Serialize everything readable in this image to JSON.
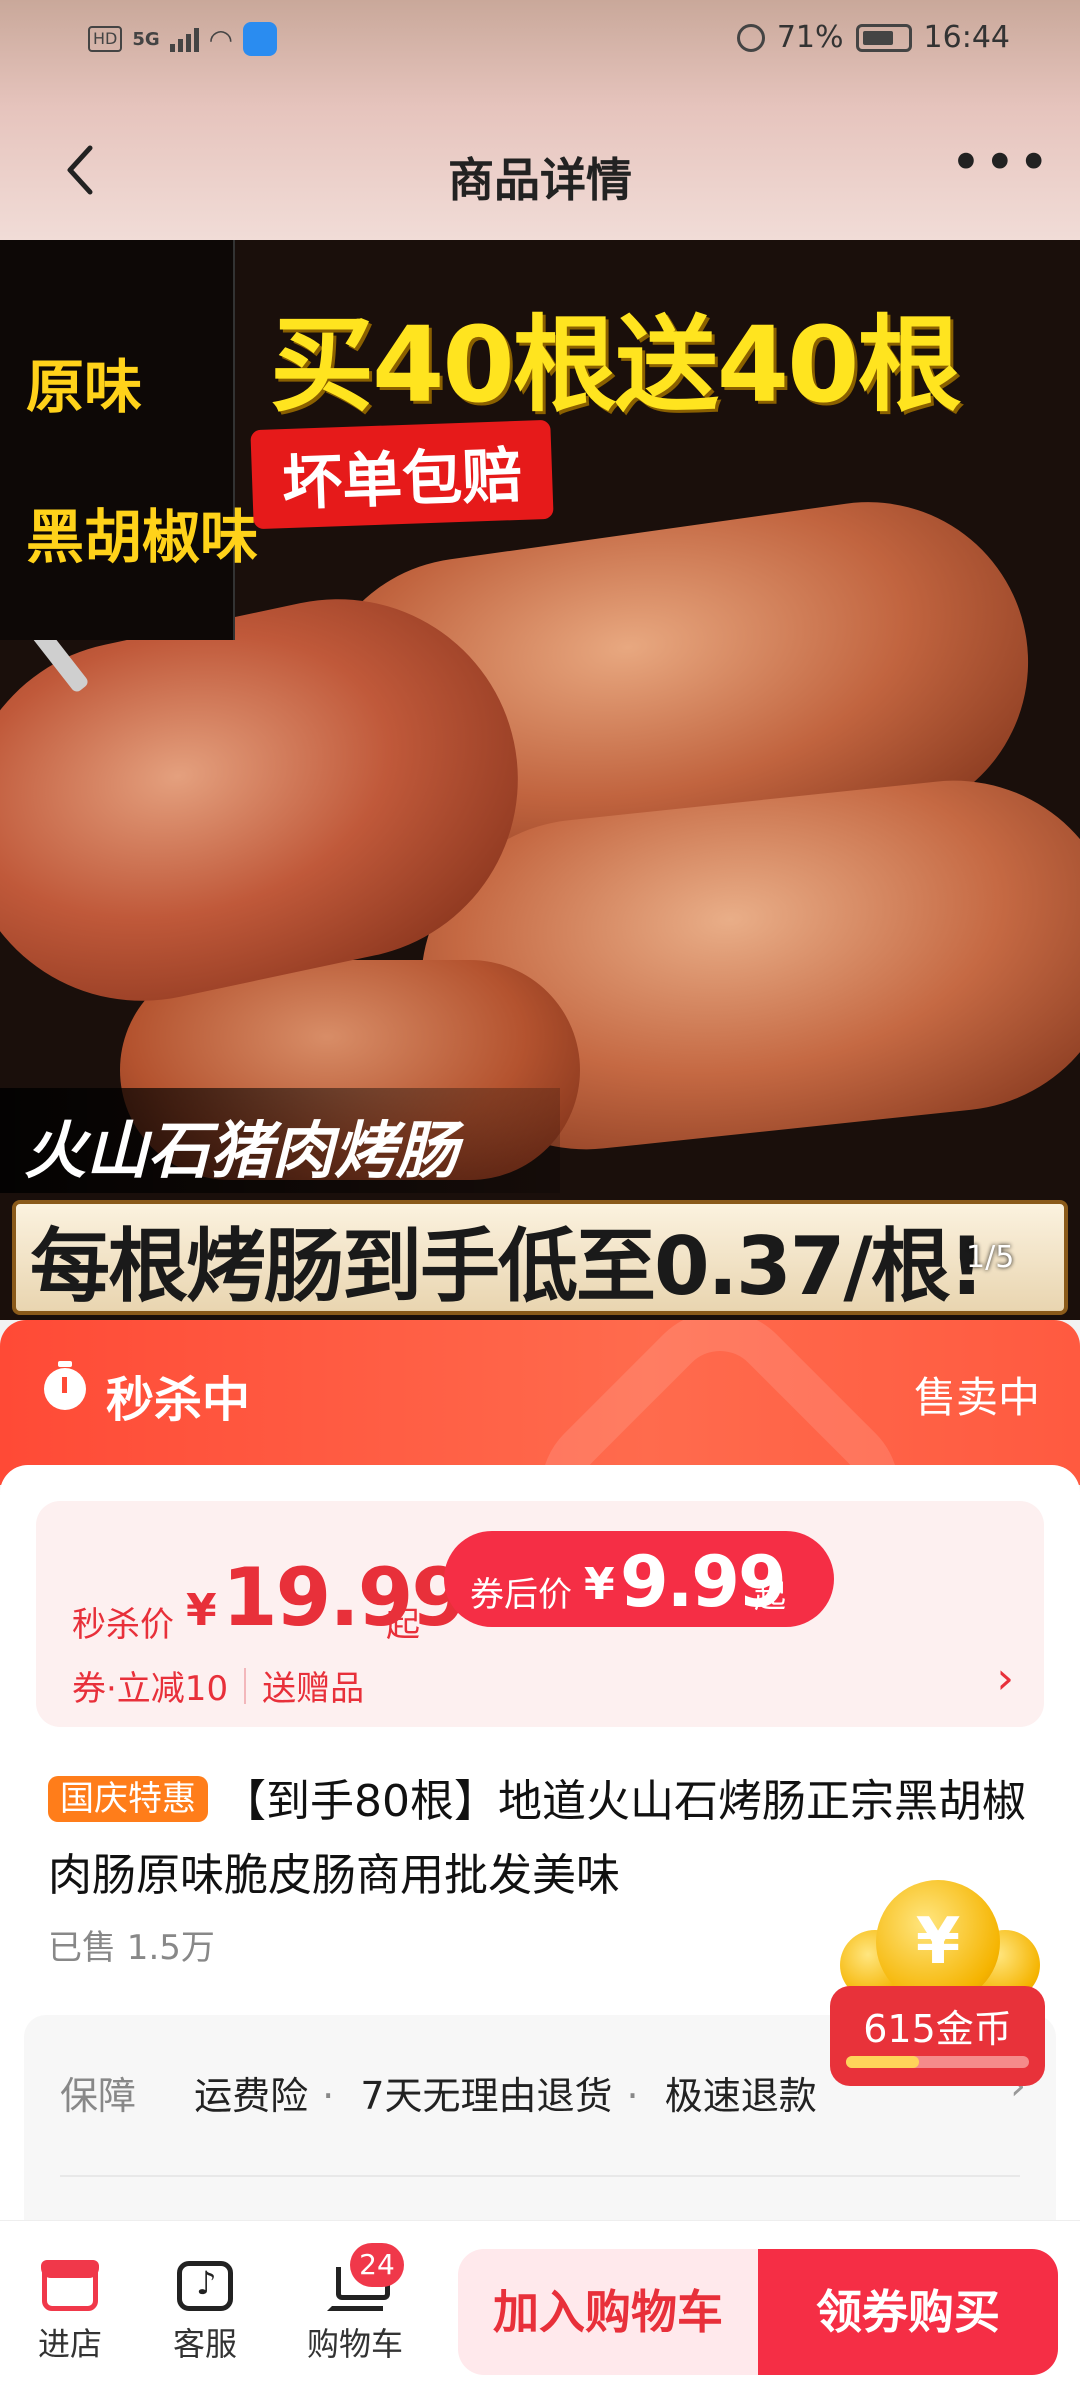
{
  "status_bar": {
    "hd": "HD",
    "network": "5G",
    "battery_pct": "71%",
    "time": "16:44"
  },
  "nav": {
    "back_icon": "chevron-left-icon",
    "title": "商品详情",
    "more_icon": "more-horizontal-icon"
  },
  "hero": {
    "flavors": [
      "原味",
      "黑胡椒味"
    ],
    "headline": "买40根送40根",
    "badge": "坏单包赔",
    "subtitle": "火山石猪肉烤肠",
    "price_banner": "每根烤肠到手低至0.37/根!",
    "counter": "1/5"
  },
  "flash_sale": {
    "title": "秒杀中",
    "status": "售卖中",
    "icon": "clock-icon"
  },
  "price": {
    "label": "秒杀价",
    "currency": "¥",
    "value": "19.99",
    "suffix": "起",
    "coupon_label": "券后价",
    "coupon_currency": "¥",
    "coupon_value": "9.99",
    "coupon_suffix": "起",
    "promo_1": "券·立减10",
    "promo_2": "送赠品"
  },
  "product": {
    "tag": "国庆特惠",
    "title": "【到手80根】地道火山石烤肠正宗黑胡椒肉肠原味脆皮肠商用批发美味",
    "sold": "已售 1.5万"
  },
  "guarantee": {
    "label": "保障",
    "items": [
      "运费险",
      "7天无理由退货",
      "极速退款"
    ]
  },
  "coins": {
    "text": "615金币",
    "symbol": "¥",
    "progress": 0.4
  },
  "bottom_bar": {
    "store": "进店",
    "service": "客服",
    "cart": "购物车",
    "cart_count": "24",
    "add_to_cart": "加入购物车",
    "buy_now": "领券购买"
  },
  "colors": {
    "accent": "#f52e45",
    "flash_bar": "#ff4a36",
    "tag": "#ff7d1a"
  }
}
